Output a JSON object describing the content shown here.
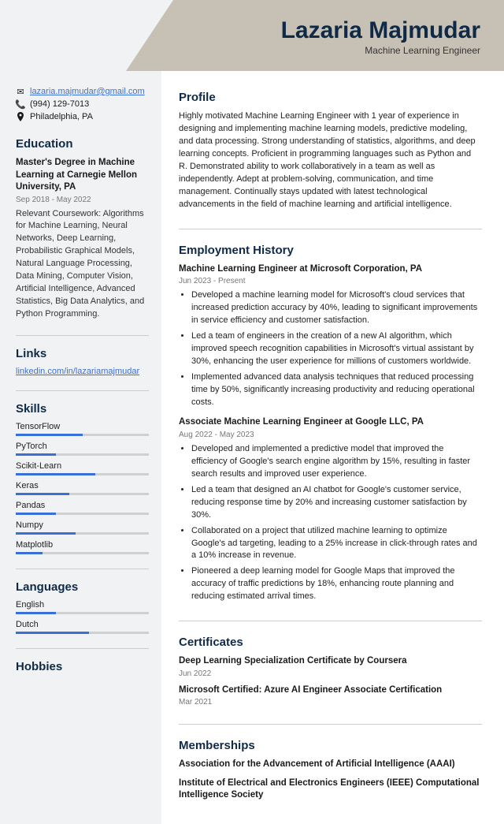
{
  "header": {
    "name": "Lazaria Majmudar",
    "subtitle": "Machine Learning Engineer"
  },
  "contact": {
    "email": "lazaria.majmudar@gmail.com",
    "phone": "(994) 129-7013",
    "location": "Philadelphia, PA"
  },
  "sections": {
    "education": "Education",
    "links": "Links",
    "skills": "Skills",
    "languages": "Languages",
    "hobbies": "Hobbies",
    "profile": "Profile",
    "employment": "Employment History",
    "certificates": "Certificates",
    "memberships": "Memberships"
  },
  "education": {
    "degree": "Master's Degree in Machine Learning at Carnegie Mellon University, PA",
    "dates": "Sep 2018 - May 2022",
    "desc": "Relevant Coursework: Algorithms for Machine Learning, Neural Networks, Deep Learning, Probabilistic Graphical Models, Natural Language Processing, Data Mining, Computer Vision, Artificial Intelligence, Advanced Statistics, Big Data Analytics, and Python Programming."
  },
  "links": {
    "linkedin": "linkedin.com/in/lazariamajmudar"
  },
  "skills": [
    {
      "name": "TensorFlow",
      "pct": 50
    },
    {
      "name": "PyTorch",
      "pct": 30
    },
    {
      "name": "Scikit-Learn",
      "pct": 60
    },
    {
      "name": "Keras",
      "pct": 40
    },
    {
      "name": "Pandas",
      "pct": 30
    },
    {
      "name": "Numpy",
      "pct": 45
    },
    {
      "name": "Matplotlib",
      "pct": 20
    }
  ],
  "languages": [
    {
      "name": "English",
      "pct": 30
    },
    {
      "name": "Dutch",
      "pct": 55
    }
  ],
  "profile": "Highly motivated Machine Learning Engineer with 1 year of experience in designing and implementing machine learning models, predictive modeling, and data processing. Strong understanding of statistics, algorithms, and deep learning concepts. Proficient in programming languages such as Python and R. Demonstrated ability to work collaboratively in a team as well as independently. Adept at problem-solving, communication, and time management. Continually stays updated with latest technological advancements in the field of machine learning and artificial intelligence.",
  "jobs": [
    {
      "title": "Machine Learning Engineer at Microsoft Corporation, PA",
      "dates": "Jun 2023 - Present",
      "bullets": [
        "Developed a machine learning model for Microsoft's cloud services that increased prediction accuracy by 40%, leading to significant improvements in service efficiency and customer satisfaction.",
        "Led a team of engineers in the creation of a new AI algorithm, which improved speech recognition capabilities in Microsoft's virtual assistant by 30%, enhancing the user experience for millions of customers worldwide.",
        "Implemented advanced data analysis techniques that reduced processing time by 50%, significantly increasing productivity and reducing operational costs."
      ]
    },
    {
      "title": "Associate Machine Learning Engineer at Google LLC, PA",
      "dates": "Aug 2022 - May 2023",
      "bullets": [
        "Developed and implemented a predictive model that improved the efficiency of Google's search engine algorithm by 15%, resulting in faster search results and improved user experience.",
        "Led a team that designed an AI chatbot for Google's customer service, reducing response time by 20% and increasing customer satisfaction by 30%.",
        "Collaborated on a project that utilized machine learning to optimize Google's ad targeting, leading to a 25% increase in click-through rates and a 10% increase in revenue.",
        "Pioneered a deep learning model for Google Maps that improved the accuracy of traffic predictions by 18%, enhancing route planning and reducing estimated arrival times."
      ]
    }
  ],
  "certificates": [
    {
      "title": "Deep Learning Specialization Certificate by Coursera",
      "date": "Jun 2022"
    },
    {
      "title": "Microsoft Certified: Azure AI Engineer Associate Certification",
      "date": "Mar 2021"
    }
  ],
  "memberships": [
    "Association for the Advancement of Artificial Intelligence (AAAI)",
    "Institute of Electrical and Electronics Engineers (IEEE) Computational Intelligence Society"
  ]
}
